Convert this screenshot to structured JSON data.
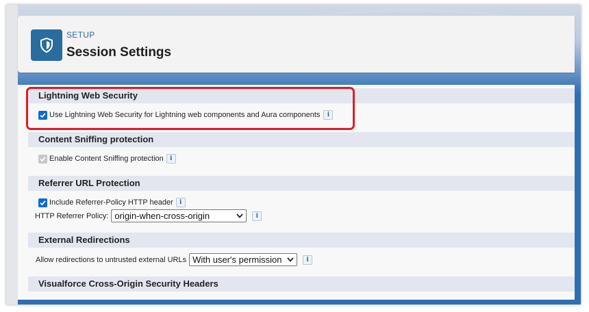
{
  "header": {
    "breadcrumb": "SETUP",
    "title": "Session Settings",
    "icon": "shield-icon",
    "icon_color": "#2a6c9e"
  },
  "sections": {
    "lws": {
      "title": "Lightning Web Security",
      "checkbox_label": "Use Lightning Web Security for Lightning web components and Aura components",
      "checked": true,
      "info": "i"
    },
    "sniff": {
      "title": "Content Sniffing protection",
      "checkbox_label": "Enable Content Sniffing protection",
      "checked": true,
      "disabled": true,
      "info": "i"
    },
    "referrer": {
      "title": "Referrer URL Protection",
      "checkbox_label": "Include Referrer-Policy HTTP header",
      "checked": true,
      "info": "i",
      "policy_label": "HTTP Referrer Policy:",
      "policy_value": "origin-when-cross-origin",
      "policy_info": "i"
    },
    "redirect": {
      "title": "External Redirections",
      "label": "Allow redirections to untrusted external URLs",
      "value": "With user's permission",
      "info": "i"
    },
    "visualforce": {
      "title": "Visualforce Cross-Origin Security Headers"
    }
  },
  "colors": {
    "accent": "#0b6bd6",
    "highlight": "#e01b23",
    "section_bg": "#e3e6ef"
  }
}
